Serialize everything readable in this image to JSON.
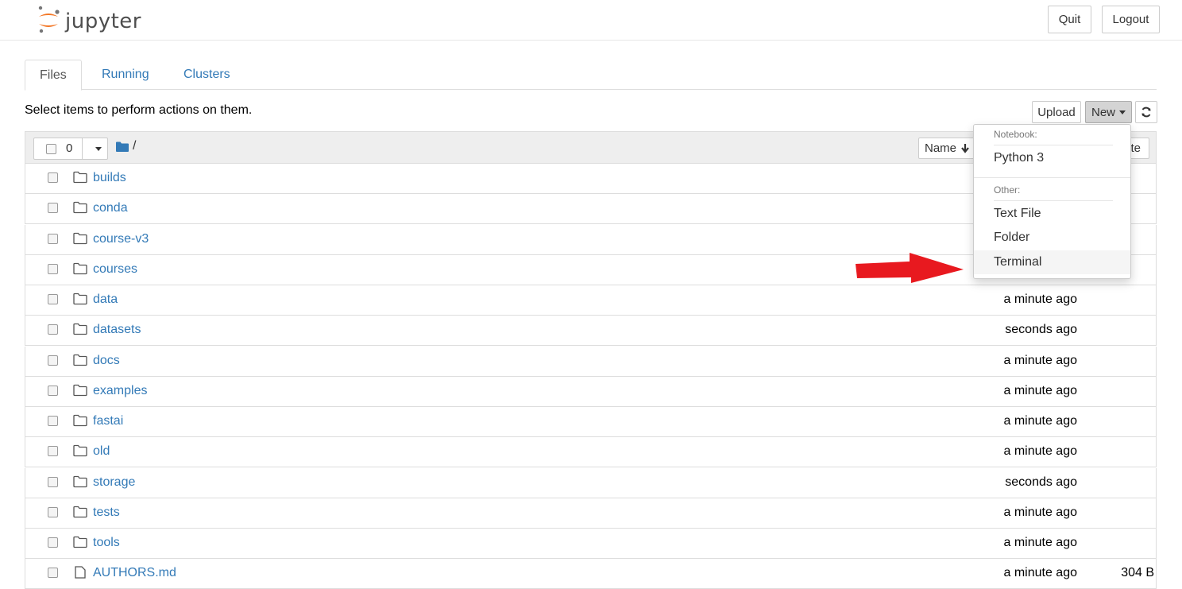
{
  "header": {
    "logo_text": "jupyter",
    "logo_icon": "jupyter-logo-icon",
    "quit_label": "Quit",
    "logout_label": "Logout"
  },
  "tabs": [
    {
      "label": "Files",
      "active": true
    },
    {
      "label": "Running",
      "active": false
    },
    {
      "label": "Clusters",
      "active": false
    }
  ],
  "toolbar": {
    "hint": "Select items to perform actions on them.",
    "upload_label": "Upload",
    "new_label": "New",
    "refresh_icon": "refresh-icon"
  },
  "list": {
    "selected_count": "0",
    "breadcrumb": "/",
    "sort_name_label": "Name",
    "sort_modified_label": "te",
    "rows": [
      {
        "name": "builds",
        "type": "folder",
        "modified": "",
        "size": ""
      },
      {
        "name": "conda",
        "type": "folder",
        "modified": "",
        "size": ""
      },
      {
        "name": "course-v3",
        "type": "folder",
        "modified": "",
        "size": ""
      },
      {
        "name": "courses",
        "type": "folder",
        "modified": "",
        "size": ""
      },
      {
        "name": "data",
        "type": "folder",
        "modified": "a minute ago",
        "size": ""
      },
      {
        "name": "datasets",
        "type": "folder",
        "modified": "seconds ago",
        "size": ""
      },
      {
        "name": "docs",
        "type": "folder",
        "modified": "a minute ago",
        "size": ""
      },
      {
        "name": "examples",
        "type": "folder",
        "modified": "a minute ago",
        "size": ""
      },
      {
        "name": "fastai",
        "type": "folder",
        "modified": "a minute ago",
        "size": ""
      },
      {
        "name": "old",
        "type": "folder",
        "modified": "a minute ago",
        "size": ""
      },
      {
        "name": "storage",
        "type": "folder",
        "modified": "seconds ago",
        "size": ""
      },
      {
        "name": "tests",
        "type": "folder",
        "modified": "a minute ago",
        "size": ""
      },
      {
        "name": "tools",
        "type": "folder",
        "modified": "a minute ago",
        "size": ""
      },
      {
        "name": "AUTHORS.md",
        "type": "file",
        "modified": "a minute ago",
        "size": "304 B"
      }
    ]
  },
  "new_menu": {
    "notebook_header": "Notebook:",
    "notebook_items": [
      "Python 3"
    ],
    "other_header": "Other:",
    "other_items": [
      "Text File",
      "Folder",
      "Terminal"
    ],
    "highlighted": "Terminal"
  },
  "annotation": {
    "arrow_color": "#e8191f"
  },
  "colors": {
    "link": "#337ab7",
    "header_border": "#e7e7e7",
    "list_header_bg": "#eeeeee",
    "logo_orange": "#f37726"
  }
}
